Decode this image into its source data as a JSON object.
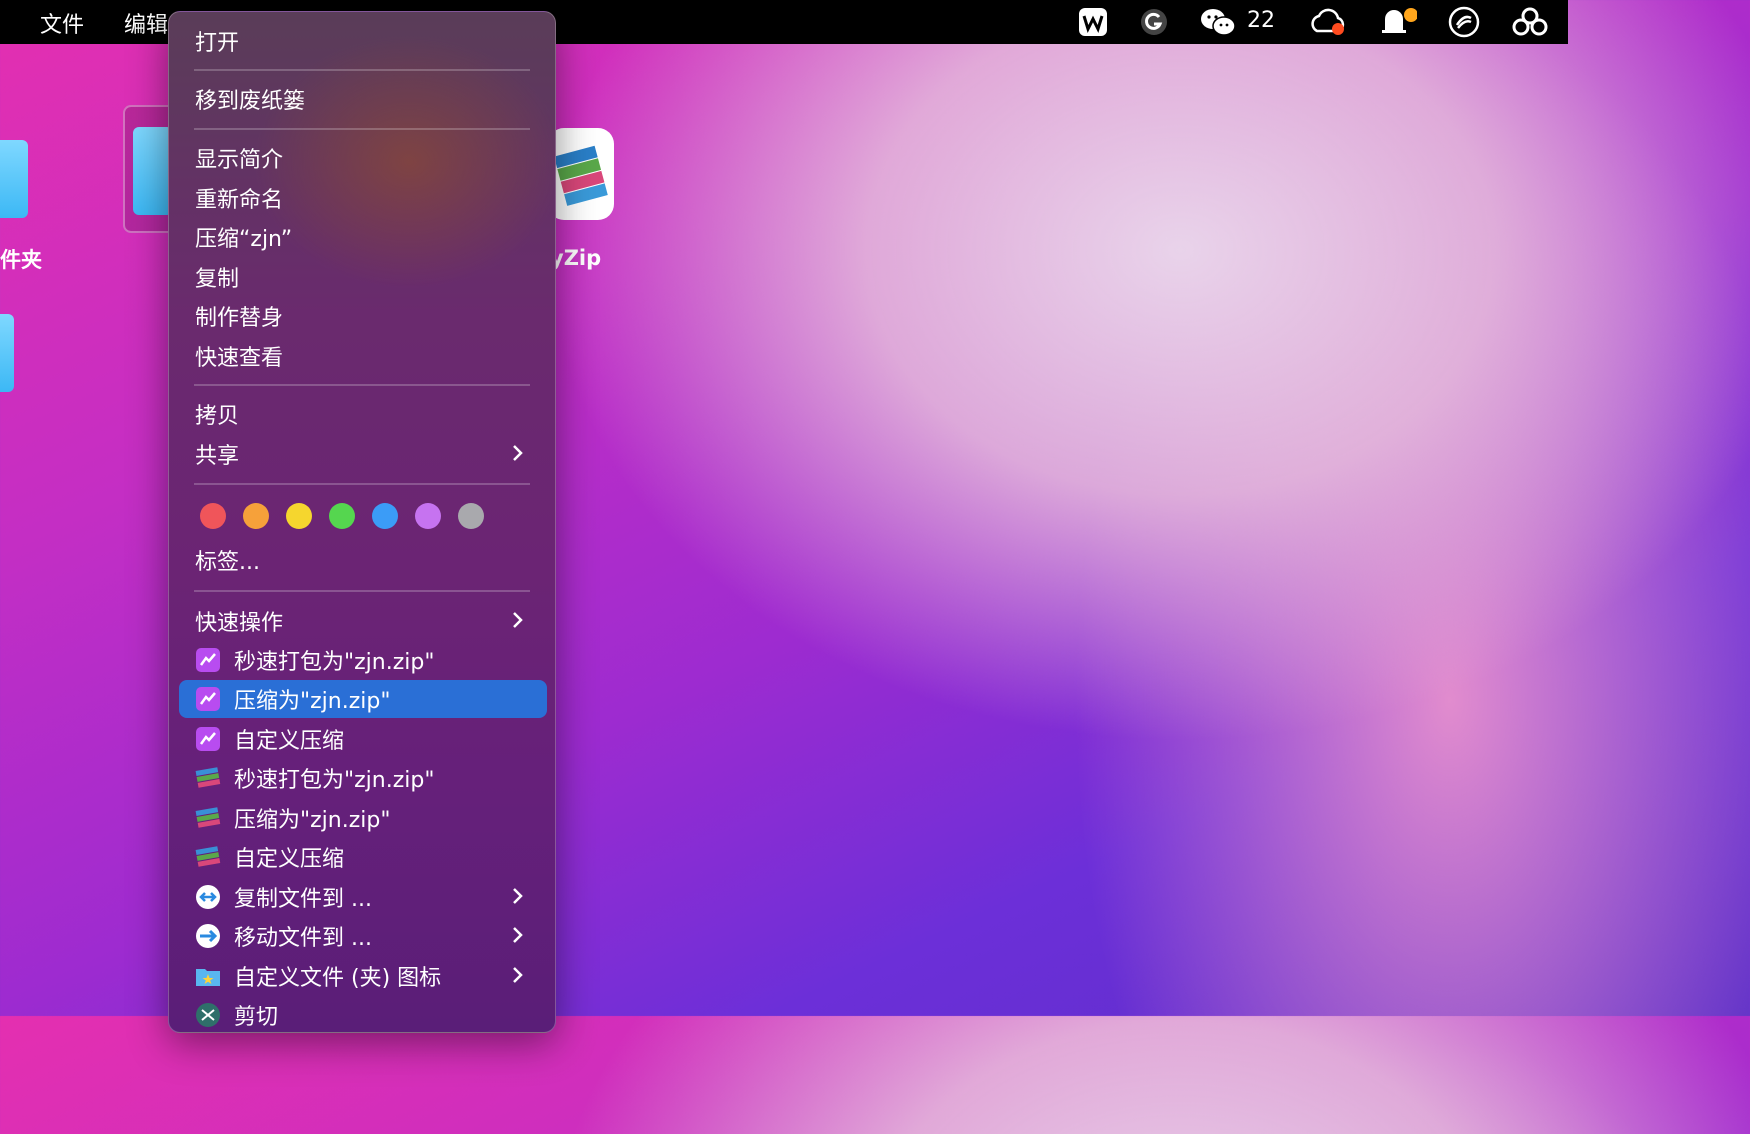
{
  "menubar": {
    "apple_fragment": "",
    "items": [
      "文件",
      "编辑"
    ],
    "wechat_count": "22"
  },
  "desktop": {
    "folder_label_left": "件夹",
    "app_label": "yZip"
  },
  "context_menu": {
    "open": "打开",
    "move_to_trash": "移到废纸篓",
    "get_info": "显示简介",
    "rename": "重新命名",
    "compress": "压缩“zjn”",
    "duplicate": "复制",
    "make_alias": "制作替身",
    "quick_look": "快速查看",
    "copy": "拷贝",
    "share": "共享",
    "tags": "标签...",
    "tag_colors": [
      "#f0555a",
      "#f6a13a",
      "#f5d62e",
      "#55d64f",
      "#3b9cf7",
      "#c673f0",
      "#a9a9ad"
    ],
    "quick_actions": "快速操作",
    "actions": [
      {
        "label": "秒速打包为\"zjn.zip\"",
        "icon": "ezip-icon"
      },
      {
        "label": "压缩为\"zjn.zip\"",
        "icon": "ezip-icon",
        "highlighted": true
      },
      {
        "label": "自定义压缩",
        "icon": "ezip-icon"
      },
      {
        "label": "秒速打包为\"zjn.zip\"",
        "icon": "books-icon"
      },
      {
        "label": "压缩为\"zjn.zip\"",
        "icon": "books-icon"
      },
      {
        "label": "自定义压缩",
        "icon": "books-icon"
      },
      {
        "label": "复制文件到 ...",
        "icon": "copy-arrow-icon",
        "submenu": true
      },
      {
        "label": "移动文件到 ...",
        "icon": "move-arrow-icon",
        "submenu": true
      },
      {
        "label": "自定义文件 (夹) 图标",
        "icon": "folder-star-icon",
        "submenu": true
      },
      {
        "label": "剪切",
        "icon": "scissors-icon"
      }
    ]
  },
  "colors": {
    "highlight": "#2a6fd6"
  }
}
